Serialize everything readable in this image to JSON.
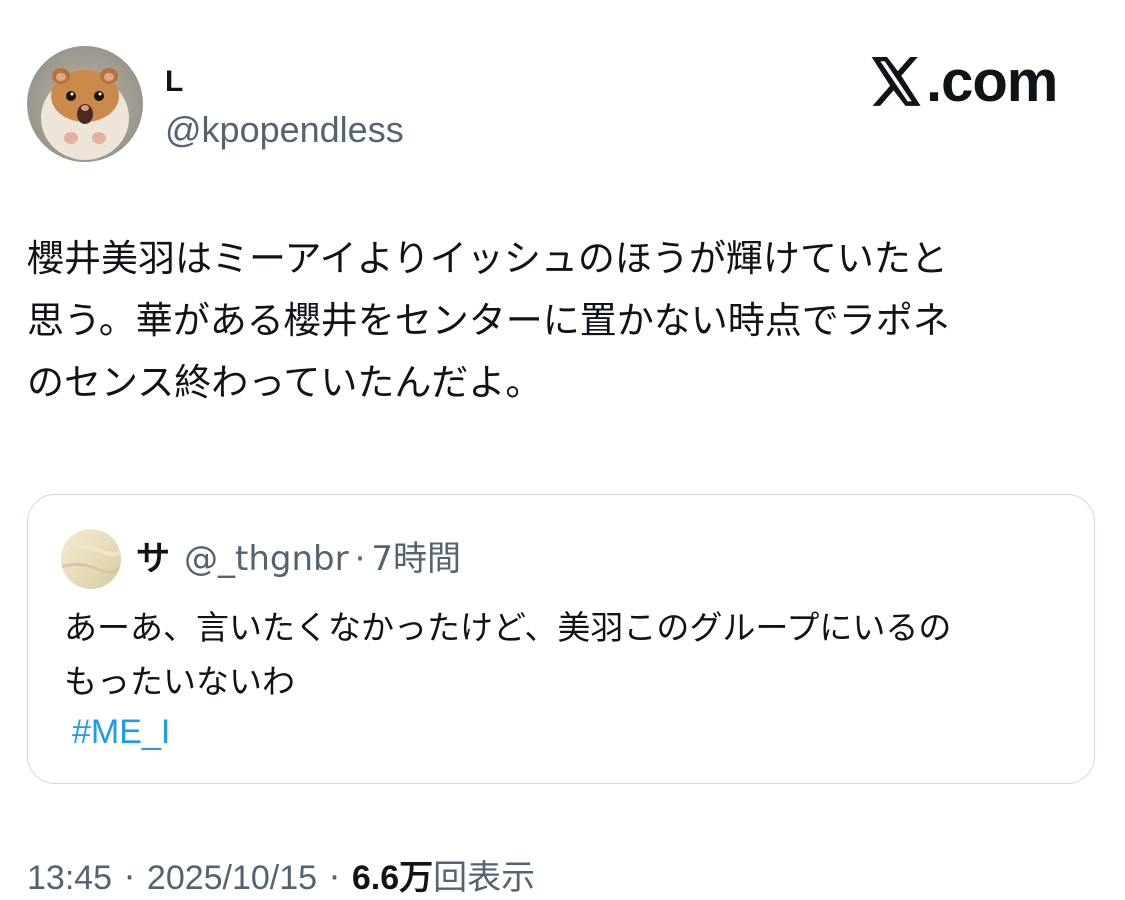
{
  "author": {
    "display_name": "L",
    "handle": "@kpopendless",
    "avatar_icon": "hamster-avatar"
  },
  "brand": {
    "logo_icon": "x-logo-icon",
    "logo_text": ".com"
  },
  "tweet": {
    "text": "櫻井美羽はミーアイよりイッシュのほうが輝けていたと\n思う。華がある櫻井をセンターに置かない時点でラポネ\nのセンス終わっていたんだよ。"
  },
  "quote": {
    "avatar_icon": "quote-avatar",
    "display_name": "サ",
    "handle": "@_thgnbr",
    "separator": "·",
    "time": "7時間",
    "text": "あーあ、言いたくなかったけど、美羽このグループにいるの\nもったいないわ",
    "hashtag": "#ME_I"
  },
  "meta": {
    "time": "13:45",
    "separator": "·",
    "date": "2025/10/15",
    "views_count": "6.6万",
    "views_label": "回表示"
  },
  "colors": {
    "text_primary": "#0f1419",
    "text_secondary": "#536471",
    "link": "#1d9bf0",
    "border": "#cfd9de"
  }
}
